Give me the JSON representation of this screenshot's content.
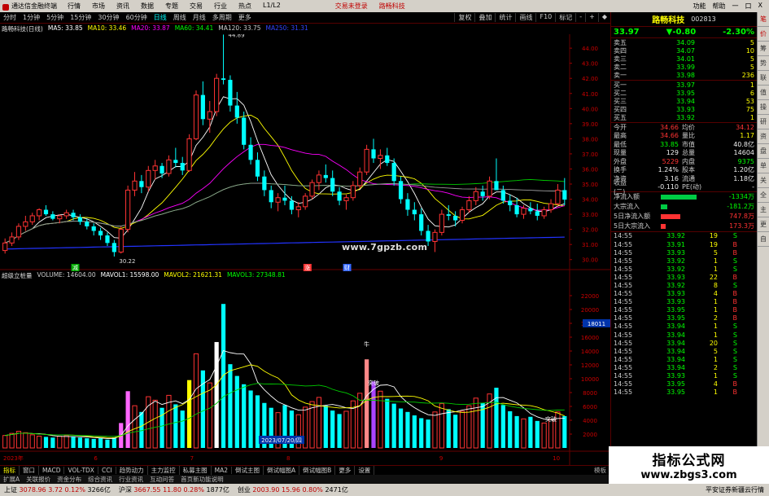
{
  "menubar": {
    "app_title": "通达信金融终端",
    "menu": [
      "行情",
      "市场",
      "资讯",
      "数据",
      "专题",
      "交易",
      "行业",
      "热点",
      "L1/L2"
    ],
    "login_text": "交易未登录",
    "stock_title": "路畅科技",
    "right": [
      "功能",
      "帮助",
      "一",
      "口",
      "X"
    ]
  },
  "periodbar": {
    "tabs": [
      "分时",
      "1分钟",
      "5分钟",
      "15分钟",
      "30分钟",
      "60分钟",
      "日线",
      "周线",
      "月线",
      "多周期",
      "更多"
    ],
    "active": "日线",
    "tools": [
      "复权",
      "叠加",
      "统计",
      "画线",
      "F10",
      "标记",
      "-",
      "+",
      "◆"
    ]
  },
  "kline_legend": {
    "title": "路畅科技(日线)",
    "items": [
      {
        "label": "MA5: 33.85",
        "color": "#ffffff"
      },
      {
        "label": "MA10: 33.46",
        "color": "#ffff00"
      },
      {
        "label": "MA20: 33.87",
        "color": "#ff00ff"
      },
      {
        "label": "MA60: 34.41",
        "color": "#00ff00"
      },
      {
        "label": "MA120: 33.75",
        "color": "#cccccc"
      },
      {
        "label": "MA250: 31.31",
        "color": "#3344ff"
      }
    ]
  },
  "vol_legend": {
    "title": "超级立桩量",
    "items": [
      {
        "label": "VOLUME: 14604.00",
        "color": "#cccccc"
      },
      {
        "label": "MAVOL1: 15598.00",
        "color": "#ffffff"
      },
      {
        "label": "MAVOL2: 21621.31",
        "color": "#ffff00"
      },
      {
        "label": "MAVOL3: 27348.81",
        "color": "#00ff00"
      }
    ]
  },
  "chart_data": {
    "type": "candlestick",
    "price_axis": {
      "ticks": [
        "44.00",
        "43.00",
        "42.00",
        "41.00",
        "40.00",
        "39.00",
        "38.00",
        "37.00",
        "36.00",
        "35.00",
        "34.00",
        "33.00",
        "32.00",
        "31.00",
        "30.00"
      ],
      "range": [
        29.5,
        44.6
      ]
    },
    "vol_axis": {
      "ticks": [
        "22000",
        "20000",
        "18000",
        "16000",
        "14000",
        "12000",
        "10000",
        "8000",
        "6000",
        "4000",
        "2000"
      ],
      "range": [
        0,
        24000
      ],
      "current_label": "18011"
    },
    "high_label": "44.89",
    "low_label": "30.22",
    "marks": [
      "减",
      "涨",
      "财"
    ],
    "vol_marks": [
      "牛",
      "突破",
      "突破"
    ],
    "date_label": "2023/07/20/四",
    "x_labels": [
      "2023年",
      "6",
      "7",
      "8",
      "9",
      "10"
    ],
    "candles": [
      [
        30.6,
        31.4,
        30.4,
        31.1
      ],
      [
        31.1,
        31.8,
        30.9,
        31.5
      ],
      [
        31.5,
        32.4,
        31.3,
        32.2
      ],
      [
        32.2,
        32.9,
        31.9,
        32.5
      ],
      [
        32.5,
        33.1,
        32.3,
        32.9
      ],
      [
        32.9,
        33.4,
        32.6,
        33.3
      ],
      [
        33.3,
        33.6,
        32.9,
        33.0
      ],
      [
        33.0,
        33.2,
        32.6,
        32.7
      ],
      [
        32.7,
        33.0,
        32.4,
        32.9
      ],
      [
        32.9,
        33.3,
        32.7,
        33.1
      ],
      [
        33.1,
        33.3,
        32.6,
        32.8
      ],
      [
        32.8,
        33.0,
        32.3,
        32.5
      ],
      [
        32.5,
        32.7,
        32.0,
        32.2
      ],
      [
        32.2,
        32.4,
        31.6,
        31.9
      ],
      [
        31.9,
        32.1,
        31.3,
        31.6
      ],
      [
        31.6,
        31.8,
        30.9,
        31.1
      ],
      [
        31.1,
        31.3,
        30.2,
        30.5
      ],
      [
        30.5,
        32.2,
        30.4,
        32.0
      ],
      [
        32.0,
        34.9,
        31.8,
        34.6
      ],
      [
        34.6,
        35.8,
        34.2,
        35.2
      ],
      [
        35.2,
        35.6,
        34.4,
        34.8
      ],
      [
        34.8,
        36.2,
        34.5,
        35.9
      ],
      [
        35.9,
        36.6,
        35.3,
        36.2
      ],
      [
        36.2,
        36.4,
        35.4,
        35.7
      ],
      [
        35.7,
        36.9,
        35.5,
        36.6
      ],
      [
        36.6,
        37.4,
        36.1,
        36.4
      ],
      [
        36.4,
        36.8,
        35.6,
        35.9
      ],
      [
        35.9,
        38.3,
        35.8,
        38.0
      ],
      [
        38.0,
        41.2,
        37.9,
        40.9
      ],
      [
        40.9,
        41.8,
        38.9,
        39.3
      ],
      [
        39.3,
        40.5,
        38.4,
        39.8
      ],
      [
        39.8,
        42.3,
        39.5,
        42.0
      ],
      [
        42.0,
        44.9,
        41.6,
        41.9
      ],
      [
        41.9,
        42.2,
        39.8,
        40.2
      ],
      [
        40.2,
        41.1,
        39.0,
        39.4
      ],
      [
        39.4,
        39.8,
        37.3,
        37.6
      ],
      [
        37.6,
        38.1,
        36.3,
        36.6
      ],
      [
        36.6,
        37.1,
        35.2,
        35.5
      ],
      [
        35.5,
        35.9,
        34.2,
        34.6
      ],
      [
        34.6,
        34.9,
        33.4,
        33.8
      ],
      [
        33.8,
        34.4,
        33.2,
        34.1
      ],
      [
        34.1,
        34.9,
        33.6,
        33.9
      ],
      [
        33.9,
        34.2,
        33.0,
        33.3
      ],
      [
        33.3,
        33.8,
        32.8,
        33.5
      ],
      [
        33.5,
        34.4,
        33.3,
        34.2
      ],
      [
        34.2,
        35.3,
        34.0,
        35.1
      ],
      [
        35.1,
        35.9,
        34.6,
        35.6
      ],
      [
        35.6,
        36.3,
        35.1,
        35.4
      ],
      [
        35.4,
        35.9,
        34.2,
        34.5
      ],
      [
        34.5,
        34.8,
        33.6,
        33.9
      ],
      [
        33.9,
        34.3,
        33.3,
        34.1
      ],
      [
        34.1,
        35.2,
        33.9,
        34.9
      ],
      [
        34.9,
        36.1,
        34.7,
        35.8
      ],
      [
        35.8,
        37.6,
        35.6,
        37.3
      ],
      [
        37.3,
        38.0,
        36.4,
        36.7
      ],
      [
        36.7,
        37.3,
        36.0,
        36.9
      ],
      [
        36.9,
        37.4,
        36.2,
        36.4
      ],
      [
        36.4,
        36.7,
        34.9,
        35.2
      ],
      [
        35.2,
        35.5,
        33.7,
        34.0
      ],
      [
        34.0,
        34.4,
        32.9,
        33.3
      ],
      [
        33.3,
        33.8,
        32.6,
        33.0
      ],
      [
        33.0,
        33.4,
        31.6,
        31.9
      ],
      [
        31.9,
        32.3,
        30.9,
        31.2
      ],
      [
        31.2,
        32.0,
        30.5,
        31.8
      ],
      [
        31.8,
        33.3,
        31.6,
        33.0
      ],
      [
        33.0,
        33.6,
        32.6,
        32.9
      ],
      [
        32.9,
        33.2,
        32.2,
        32.6
      ],
      [
        32.6,
        33.5,
        32.4,
        33.3
      ],
      [
        33.3,
        34.2,
        33.1,
        33.9
      ],
      [
        33.9,
        34.8,
        33.6,
        34.5
      ],
      [
        34.5,
        34.9,
        33.9,
        34.2
      ],
      [
        34.2,
        35.5,
        34.0,
        35.2
      ],
      [
        35.2,
        36.7,
        34.9,
        34.6
      ],
      [
        34.6,
        34.9,
        33.7,
        33.9
      ],
      [
        33.9,
        34.3,
        33.2,
        33.6
      ],
      [
        33.6,
        34.1,
        32.8,
        33.0
      ],
      [
        33.0,
        33.6,
        32.7,
        33.4
      ],
      [
        33.4,
        33.8,
        33.0,
        33.2
      ],
      [
        33.2,
        33.7,
        32.6,
        32.9
      ],
      [
        32.9,
        33.5,
        32.7,
        33.3
      ],
      [
        33.3,
        34.0,
        33.1,
        33.7
      ],
      [
        33.7,
        35.0,
        33.5,
        34.6
      ],
      [
        34.6,
        35.4,
        33.6,
        33.97
      ]
    ],
    "volumes": [
      1800,
      2100,
      2400,
      2200,
      1900,
      1700,
      1600,
      1500,
      1700,
      1800,
      1600,
      1500,
      1400,
      1300,
      1400,
      1200,
      1500,
      3600,
      8200,
      6100,
      5200,
      7400,
      6900,
      5800,
      7600,
      6300,
      5400,
      9800,
      13600,
      11200,
      9400,
      15300,
      20800,
      12100,
      10400,
      9200,
      8300,
      7600,
      6500,
      5800,
      5100,
      6200,
      5400,
      4800,
      5900,
      6700,
      7300,
      6100,
      5400,
      4900,
      5300,
      6800,
      7900,
      12800,
      9600,
      8200,
      7100,
      6400,
      5700,
      5200,
      4700,
      4300,
      4100,
      5200,
      6400,
      5600,
      4800,
      5300,
      6100,
      7200,
      6500,
      7800,
      8700,
      6200,
      5300,
      4600,
      4200,
      4500,
      3900,
      3600,
      4100,
      5200,
      4600
    ],
    "ma_lines": [
      "MA5",
      "MA10",
      "MA20",
      "MA60",
      "MA120",
      "MA250"
    ]
  },
  "orderbook": {
    "header_name": "路畅科技",
    "header_code": "002813",
    "price": "33.97",
    "change": "▼-0.80",
    "change_pct": "-2.30%",
    "asks": [
      {
        "label": "卖五",
        "price": "34.09",
        "qty": "5"
      },
      {
        "label": "卖四",
        "price": "34.07",
        "qty": "10"
      },
      {
        "label": "卖三",
        "price": "34.01",
        "qty": "5"
      },
      {
        "label": "卖二",
        "price": "33.99",
        "qty": "5"
      },
      {
        "label": "卖一",
        "price": "33.98",
        "qty": "236"
      }
    ],
    "bids": [
      {
        "label": "买一",
        "price": "33.97",
        "qty": "1"
      },
      {
        "label": "买二",
        "price": "33.95",
        "qty": "6"
      },
      {
        "label": "买三",
        "price": "33.94",
        "qty": "53"
      },
      {
        "label": "买四",
        "price": "33.93",
        "qty": "75"
      },
      {
        "label": "买五",
        "price": "33.92",
        "qty": "1"
      }
    ]
  },
  "stats": [
    {
      "l1": "今开",
      "v1": "34.66",
      "c1": "redc",
      "l2": "均价",
      "v2": "34.12",
      "c2": "redc"
    },
    {
      "l1": "最高",
      "v1": "34.66",
      "c1": "redc",
      "l2": "量比",
      "v2": "1.17",
      "c2": "yel"
    },
    {
      "l1": "最低",
      "v1": "33.85",
      "c1": "grn",
      "l2": "市值",
      "v2": "40.8亿",
      "c2": "wht"
    },
    {
      "l1": "现量",
      "v1": "129",
      "c1": "wht",
      "l2": "总量",
      "v2": "14604",
      "c2": "wht"
    },
    {
      "l1": "外盘",
      "v1": "5229",
      "c1": "redc",
      "l2": "内盘",
      "v2": "9375",
      "c2": "grn"
    },
    {
      "l1": "换手",
      "v1": "1.24%",
      "c1": "wht",
      "l2": "股本",
      "v2": "1.20亿",
      "c2": "wht"
    },
    {
      "l1": "净资",
      "v1": "3.16",
      "c1": "wht",
      "l2": "流通",
      "v2": "1.18亿",
      "c2": "wht"
    },
    {
      "l1": "收益(二)",
      "v1": "-0.110",
      "c1": "wht",
      "l2": "PE(动)",
      "v2": "-",
      "c2": "wht"
    }
  ],
  "flows": [
    {
      "label": "净流入额",
      "val": "-1334万",
      "cls": "grn",
      "bar": 0.55,
      "color": "#00cc44"
    },
    {
      "label": "大宗流入",
      "val": "-181.2万",
      "cls": "grn",
      "bar": 0.1,
      "color": "#00cc44"
    },
    {
      "label": "5日净流入额",
      "val": "747.8万",
      "cls": "redc",
      "bar": 0.3,
      "color": "#ff3333"
    },
    {
      "label": "5日大宗流入",
      "val": "173.3万",
      "cls": "redc",
      "bar": 0.08,
      "color": "#ff3333"
    }
  ],
  "ticks": [
    {
      "t": "14:55",
      "p": "33.92",
      "v": "19",
      "s": "S"
    },
    {
      "t": "14:55",
      "p": "33.91",
      "v": "19",
      "s": "B"
    },
    {
      "t": "14:55",
      "p": "33.93",
      "v": "5",
      "s": "B"
    },
    {
      "t": "14:55",
      "p": "33.92",
      "v": "1",
      "s": "S"
    },
    {
      "t": "14:55",
      "p": "33.92",
      "v": "1",
      "s": "S"
    },
    {
      "t": "14:55",
      "p": "33.93",
      "v": "22",
      "s": "B"
    },
    {
      "t": "14:55",
      "p": "33.92",
      "v": "8",
      "s": "S"
    },
    {
      "t": "14:55",
      "p": "33.93",
      "v": "4",
      "s": "B"
    },
    {
      "t": "14:55",
      "p": "33.93",
      "v": "1",
      "s": "B"
    },
    {
      "t": "14:55",
      "p": "33.95",
      "v": "1",
      "s": "B"
    },
    {
      "t": "14:55",
      "p": "33.95",
      "v": "2",
      "s": "B"
    },
    {
      "t": "14:55",
      "p": "33.94",
      "v": "1",
      "s": "S"
    },
    {
      "t": "14:55",
      "p": "33.94",
      "v": "1",
      "s": "S"
    },
    {
      "t": "14:55",
      "p": "33.94",
      "v": "20",
      "s": "S"
    },
    {
      "t": "14:55",
      "p": "33.94",
      "v": "5",
      "s": "S"
    },
    {
      "t": "14:55",
      "p": "33.94",
      "v": "1",
      "s": "S"
    },
    {
      "t": "14:55",
      "p": "33.94",
      "v": "2",
      "s": "S"
    },
    {
      "t": "14:55",
      "p": "33.93",
      "v": "1",
      "s": "S"
    },
    {
      "t": "14:55",
      "p": "33.95",
      "v": "4",
      "s": "B"
    },
    {
      "t": "14:55",
      "p": "33.95",
      "v": "1",
      "s": "B"
    }
  ],
  "indbar": {
    "tabs": [
      "指标",
      "窗口",
      "MACD",
      "VOL-TDX",
      "CCI",
      "趋势动力",
      "主力监控",
      "私募主图",
      "MA2",
      "倒试主图",
      "倒试幅图A",
      "倒试幅图B",
      "更多",
      "设置"
    ],
    "active": "指标",
    "right": "模板"
  },
  "indbar2": [
    "扩展A",
    "关联报价",
    "资金分布",
    "综合资讯",
    "行业资讯",
    "互动问答",
    "首页新功能说明"
  ],
  "statusbar": {
    "items": [
      {
        "name": "上证",
        "val": "3078.96",
        "chg": "3.72",
        "pct": "0.12%",
        "amt": "3266亿"
      },
      {
        "name": "沪深",
        "val": "3667.55",
        "chg": "11.80",
        "pct": "0.28%",
        "amt": "1877亿"
      },
      {
        "name": "创业",
        "val": "2003.90",
        "chg": "15.96",
        "pct": "0.80%",
        "amt": "2471亿"
      }
    ],
    "right": "平安证券新疆云行情"
  },
  "vtabs": [
    "笔",
    "价",
    "筹",
    "势",
    "联",
    "值",
    "操",
    "研",
    "资",
    "盘",
    "单",
    "关",
    "全",
    "主",
    "更",
    "自"
  ],
  "watermark_site": "www.7gpzb.com",
  "watermark_logo_line1": "指标公式网",
  "watermark_logo_line2": "www.zbgs3.com"
}
